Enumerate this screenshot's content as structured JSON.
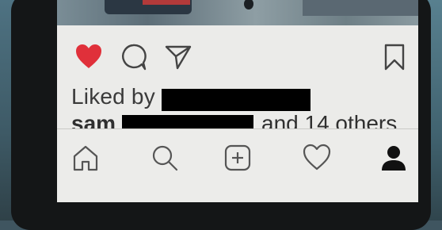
{
  "post": {
    "liked_by_label": "Liked by",
    "second_line_user": "sam",
    "second_line_suffix": "and 14 others"
  },
  "icons": {
    "like": "heart-filled-icon",
    "comment": "comment-icon",
    "share": "direct-share-icon",
    "save": "bookmark-icon"
  },
  "tabs": [
    {
      "name": "home",
      "icon": "home-icon"
    },
    {
      "name": "search",
      "icon": "search-icon"
    },
    {
      "name": "new-post",
      "icon": "add-post-icon"
    },
    {
      "name": "activity",
      "icon": "heart-outline-icon"
    },
    {
      "name": "profile",
      "icon": "profile-icon"
    }
  ],
  "colors": {
    "like_red": "#e0303a",
    "screen_bg": "#ebebe9",
    "icon_gray": "#555555"
  }
}
